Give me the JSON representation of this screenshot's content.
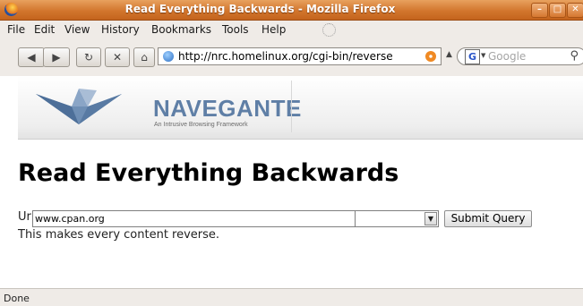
{
  "window": {
    "title": "Read Everything Backwards - Mozilla Firefox"
  },
  "menu": {
    "items": [
      "File",
      "Edit",
      "View",
      "History",
      "Bookmarks",
      "Tools",
      "Help"
    ]
  },
  "toolbar": {
    "url": "http://nrc.homelinux.org/cgi-bin/reverse",
    "search_placeholder": "Google",
    "search_engine_letter": "G"
  },
  "header": {
    "brand": "NAVEGANTE",
    "tagline": "An Intrusive Browsing Framework"
  },
  "page": {
    "title": "Read Everything Backwards",
    "url_label": "Url",
    "url_value": "www.cpan.org",
    "submit_label": "Submit Query",
    "description": "This makes every content reverse."
  },
  "status": {
    "text": "Done"
  },
  "colors": {
    "titlebar": "#d2762d",
    "brand": "#5f7fa6",
    "background": "#efebe7"
  }
}
